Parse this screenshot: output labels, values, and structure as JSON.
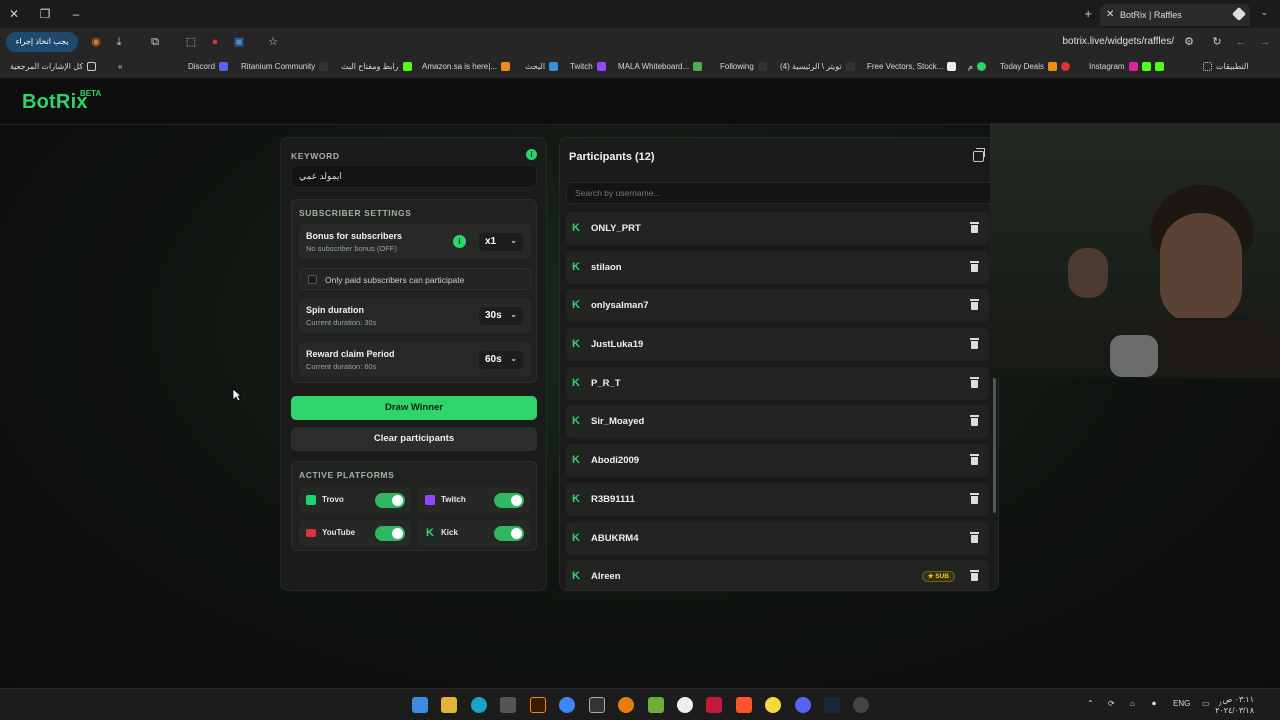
{
  "browser": {
    "tab_title": "BotRix | Raffles",
    "url": "botrix.live/widgets/raffles/",
    "update_button": "يجب اتخاذ إجراء",
    "bookmarks": [
      "Discord",
      "Ritanium Community",
      "رابط ومفتاح البث",
      "Amazon.sa is here|...",
      "البحث",
      "Twitch",
      "MALA Whiteboard...",
      "Following",
      "(4) تويتر \\ الرئيسية",
      "Free Vectors, Stock...",
      "م",
      "Today Deals",
      "Instagram",
      "التطبيقات"
    ],
    "all_bookmarks": "كل الإشارات المرجعية"
  },
  "header": {
    "logo": "BotRix",
    "beta": "BETA"
  },
  "raffle": {
    "keyword_label": "KEYWORD",
    "keyword_value": "ايمولد عمي",
    "subscriber_settings_label": "SUBSCRIBER SETTINGS",
    "bonus": {
      "title": "Bonus for subscribers",
      "subtitle": "No subscriber bonus (OFF)",
      "value": "x1"
    },
    "paid_only_label": "Only paid subscribers can participate",
    "spin": {
      "title": "Spin duration",
      "subtitle": "Current duration: 30s",
      "value": "30s"
    },
    "reward": {
      "title": "Reward claim Period",
      "subtitle": "Current duration: 60s",
      "value": "60s"
    },
    "draw_winner": "Draw Winner",
    "clear_participants": "Clear participants",
    "active_platforms_label": "ACTIVE PLATFORMS",
    "platforms": [
      {
        "name": "Trovo",
        "enabled": true
      },
      {
        "name": "Twitch",
        "enabled": true
      },
      {
        "name": "YouTube",
        "enabled": true
      },
      {
        "name": "Kick",
        "enabled": true
      }
    ]
  },
  "participants": {
    "title": "Participants (12)",
    "search_placeholder": "Search by username...",
    "list": [
      {
        "user": "ONLY_PRT"
      },
      {
        "user": "stilaon"
      },
      {
        "user": "onlysalman7"
      },
      {
        "user": "JustLuka19"
      },
      {
        "user": "P_R_T"
      },
      {
        "user": "Sir_Moayed"
      },
      {
        "user": "Abodi2009"
      },
      {
        "user": "R3B91111"
      },
      {
        "user": "ABUKRM4"
      },
      {
        "user": "Alreen",
        "badge": "SUB"
      }
    ]
  },
  "taskbar": {
    "lang": "ENG",
    "time": "٠٣:١١ ص",
    "date": "٢٠٢٤/٠٣/١٨"
  },
  "colors": {
    "accent": "#2fd46b",
    "panel": "#1a1b1a",
    "page_bg": "#0f100f"
  }
}
